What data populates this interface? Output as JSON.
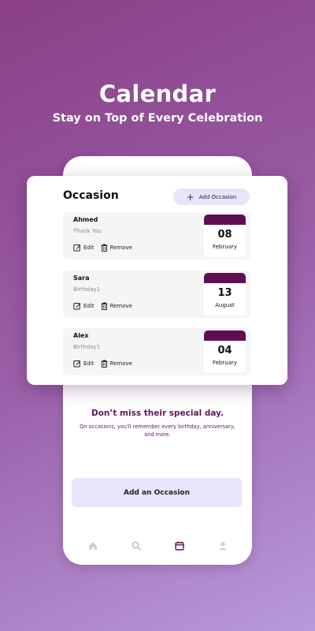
{
  "hero": {
    "title": "Calendar",
    "subtitle": "Stay on Top of Every Celebration"
  },
  "card": {
    "title": "Occasion",
    "add_button_label": "Add Occasion",
    "occasions": [
      {
        "name": "Ahmed",
        "note": "Thank You",
        "day": "08",
        "month": "February",
        "edit_label": "Edit",
        "remove_label": "Remove"
      },
      {
        "name": "Sara",
        "note": "Birthday1",
        "day": "13",
        "month": "August",
        "edit_label": "Edit",
        "remove_label": "Remove"
      },
      {
        "name": "Alex",
        "note": "Birthday1",
        "day": "04",
        "month": "February",
        "edit_label": "Edit",
        "remove_label": "Remove"
      }
    ]
  },
  "phone": {
    "heading": "Don’t miss their special day.",
    "body": "On occasions, you'll remember every birthday, anniversary, and more.",
    "cta_label": "Add an Occasion",
    "nav": [
      "home-icon",
      "search-icon",
      "calendar-icon",
      "profile-icon"
    ]
  },
  "colors": {
    "accent": "#5e0f54",
    "button_bg": "#e9e3fb",
    "heading_purple": "#5b1a5e"
  }
}
